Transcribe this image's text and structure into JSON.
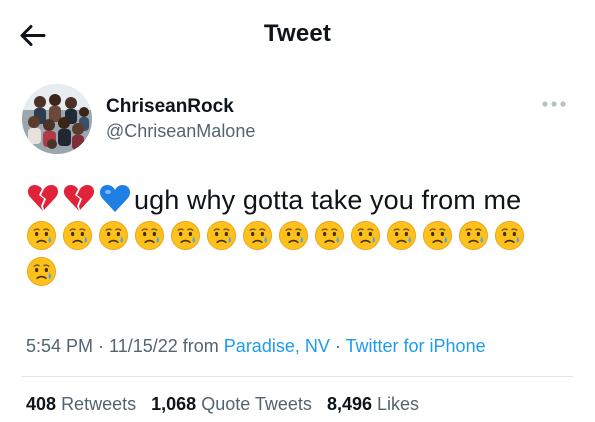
{
  "header": {
    "title": "Tweet"
  },
  "author": {
    "display_name": "ChriseanRock",
    "handle": "@ChriseanMalone"
  },
  "tweet": {
    "text": "ugh why gotta take you from me",
    "leading_emoji": [
      "broken-heart",
      "broken-heart",
      "blue-heart"
    ],
    "crying_emoji_count": 15
  },
  "meta": {
    "time": "5:54 PM",
    "sep1": " · ",
    "date": "11/15/22",
    "from_text": " from ",
    "location": "Paradise, NV",
    "sep2": " · ",
    "source": "Twitter for iPhone"
  },
  "stats": {
    "retweets_count": "408",
    "retweets_label": "Retweets",
    "quotes_count": "1,068",
    "quotes_label": "Quote Tweets",
    "likes_count": "8,496",
    "likes_label": "Likes"
  },
  "colors": {
    "link": "#1d9bf0",
    "muted": "#536471",
    "text": "#0f1419",
    "broken_heart": "#e1233a",
    "blue_heart": "#1f7fe5"
  }
}
